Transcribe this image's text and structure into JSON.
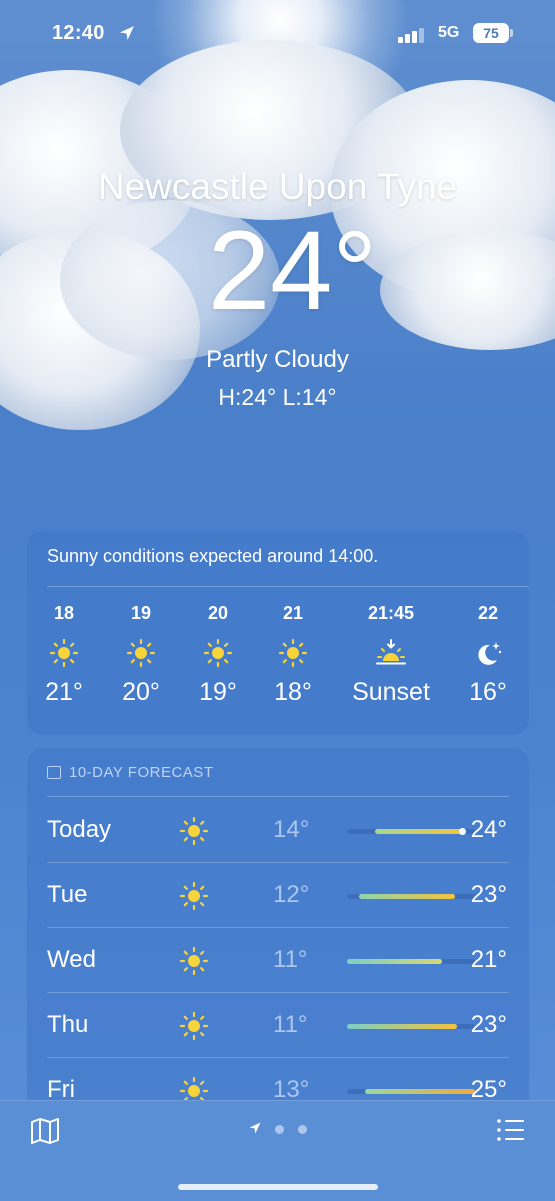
{
  "status_bar": {
    "time": "12:40",
    "network": "5G",
    "battery": "75"
  },
  "location": {
    "city": "Newcastle Upon Tyne",
    "temperature": "24°",
    "condition": "Partly Cloudy",
    "high_low": "H:24°  L:14°"
  },
  "hourly": {
    "summary": "Sunny conditions expected around 14:00.",
    "hours": [
      {
        "label": "18",
        "icon": "sun-icon",
        "temp": "21°"
      },
      {
        "label": "19",
        "icon": "sun-icon",
        "temp": "20°"
      },
      {
        "label": "20",
        "icon": "sun-icon",
        "temp": "19°"
      },
      {
        "label": "21",
        "icon": "sun-icon",
        "temp": "18°"
      },
      {
        "label": "21:45",
        "icon": "sunset-icon",
        "temp": "Sunset"
      },
      {
        "label": "22",
        "icon": "moon-stars-icon",
        "temp": "16°"
      }
    ]
  },
  "ten_day": {
    "title": "10-DAY FORECAST",
    "days": [
      {
        "day": "Today",
        "icon": "sun-icon",
        "low": "14°",
        "high": "24°",
        "range_start": 0.22,
        "range_end": 0.9,
        "current": 0.9,
        "colors": [
          "#a8d88a",
          "#f4c33b"
        ]
      },
      {
        "day": "Tue",
        "icon": "sun-icon",
        "low": "12°",
        "high": "23°",
        "range_start": 0.09,
        "range_end": 0.84,
        "colors": [
          "#8fd5b0",
          "#f4c33b"
        ]
      },
      {
        "day": "Wed",
        "icon": "sun-icon",
        "low": "11°",
        "high": "21°",
        "range_start": 0.0,
        "range_end": 0.74,
        "colors": [
          "#7ccfc4",
          "#d8d870"
        ]
      },
      {
        "day": "Thu",
        "icon": "sun-icon",
        "low": "11°",
        "high": "23°",
        "range_start": 0.0,
        "range_end": 0.86,
        "colors": [
          "#7ccfc4",
          "#f4c33b"
        ]
      },
      {
        "day": "Fri",
        "icon": "sun-icon",
        "low": "13°",
        "high": "25°",
        "range_start": 0.14,
        "range_end": 1.0,
        "colors": [
          "#9bd8a0",
          "#f3a93a"
        ]
      }
    ]
  },
  "tab_bar": {
    "map_icon": "map-icon",
    "list_icon": "list-icon",
    "page_indicator": {
      "current": "location-arrow-icon",
      "pages": 3
    }
  }
}
